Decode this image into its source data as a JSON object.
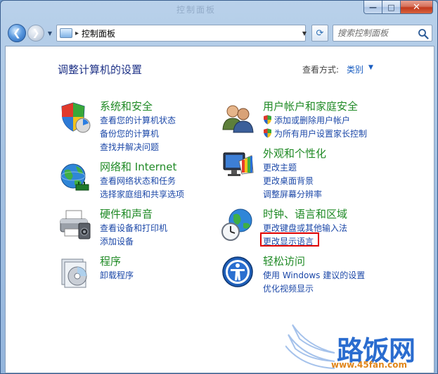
{
  "window": {
    "title_faded": "控制面板",
    "close_glyph": "✕",
    "max_glyph": "□",
    "min_glyph": "—"
  },
  "navbar": {
    "back_icon": "back-arrow-icon",
    "forward_icon": "forward-arrow-icon",
    "breadcrumb": "控制面板",
    "breadcrumb_sep": "▸",
    "search_placeholder": "搜索控制面板",
    "refresh_glyph": "⟳"
  },
  "header": {
    "title": "调整计算机的设置",
    "view_by_label": "查看方式:",
    "view_by_value": "类别"
  },
  "categories": {
    "system": {
      "title": "系统和安全",
      "icon": "shield-security-icon",
      "links": [
        "查看您的计算机状态",
        "备份您的计算机",
        "查找并解决问题"
      ]
    },
    "network": {
      "title": "网络和 Internet",
      "icon": "globe-network-icon",
      "links": [
        "查看网络状态和任务",
        "选择家庭组和共享选项"
      ]
    },
    "hardware": {
      "title": "硬件和声音",
      "icon": "printer-icon",
      "links": [
        "查看设备和打印机",
        "添加设备"
      ]
    },
    "programs": {
      "title": "程序",
      "icon": "programs-disk-icon",
      "links": [
        "卸载程序"
      ]
    },
    "users": {
      "title": "用户帐户和家庭安全",
      "icon": "users-icon",
      "links": [
        "添加或删除用户帐户",
        "为所有用户设置家长控制"
      ]
    },
    "appearance": {
      "title": "外观和个性化",
      "icon": "monitor-palette-icon",
      "links": [
        "更改主题",
        "更改桌面背景",
        "调整屏幕分辨率"
      ]
    },
    "clock": {
      "title": "时钟、语言和区域",
      "icon": "clock-globe-icon",
      "links": [
        "更改键盘或其他输入法",
        "更改显示语言"
      ]
    },
    "ease": {
      "title": "轻松访问",
      "icon": "ease-of-access-icon",
      "links": [
        "使用 Windows 建议的设置",
        "优化视频显示"
      ]
    }
  },
  "watermark": {
    "text": "路饭网",
    "url": "www.45fan.com"
  },
  "colors": {
    "category_title": "#1f8a25",
    "link": "#1c48a8",
    "heading": "#1e3287",
    "highlight": "#e00000"
  }
}
